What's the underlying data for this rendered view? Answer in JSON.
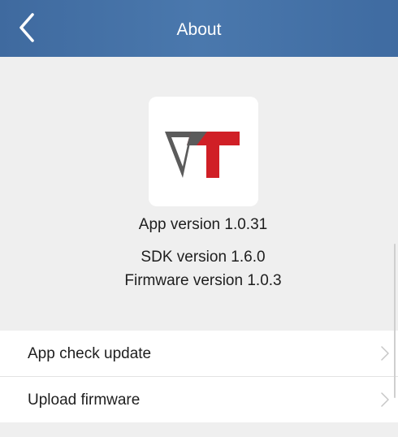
{
  "header": {
    "title": "About",
    "back_icon": "chevron-left-icon",
    "background": "#4574a9"
  },
  "logo": {
    "name": "vt-app-logo",
    "colors": {
      "gray": "#5b5b5b",
      "red": "#d01f26"
    }
  },
  "info": {
    "app_version": "App version 1.0.31",
    "sdk_version": "SDK version 1.6.0",
    "firmware_version": "Firmware version 1.0.3"
  },
  "menu": {
    "items": [
      {
        "label": "App check update",
        "icon": "chevron-right-icon"
      },
      {
        "label": "Upload firmware",
        "icon": "chevron-right-icon"
      }
    ]
  }
}
